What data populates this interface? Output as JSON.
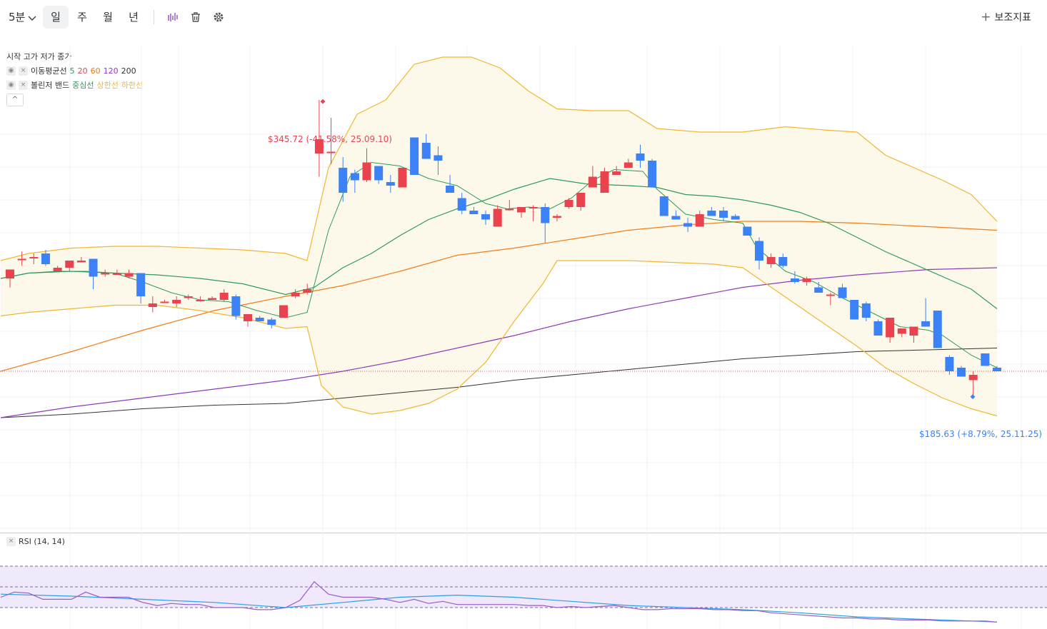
{
  "toolbar": {
    "interval": "5분",
    "day": "일",
    "week": "주",
    "month": "월",
    "year": "년",
    "indicators": "보조지표"
  },
  "legend": {
    "ohlc": "시작 고가 저가 종가",
    "ma_name": "이동평균선",
    "ma_periods": [
      "5",
      "20",
      "60",
      "120",
      "200"
    ],
    "bb_name": "볼린저 밴드",
    "bb_mid": "중심선",
    "bb_upper": "상한선",
    "bb_lower": "하한선"
  },
  "colors": {
    "up": "#e8434f",
    "down": "#3b82f6",
    "ma5": "#2e9b5a",
    "ma20": "#e8434f",
    "ma60": "#f07d1a",
    "ma120": "#8e3bb8",
    "ma200": "#333333",
    "bb_mid": "#2e9b5a",
    "bb_band": "#f2b632",
    "bb_fill": "#fdf9ea",
    "rsi": "#9b5cc4",
    "rsi_signal": "#27a0e8",
    "rsi_band": "#efe9fb"
  },
  "annotations": {
    "high": "$345.72 (-41.58%, 25.09.10)",
    "low": "$185.63 (+8.79%, 25.11.25)"
  },
  "rsi": {
    "label": "RSI (14, 14)"
  },
  "chart_data": {
    "type": "candlestick",
    "ylim": [
      140,
      380
    ],
    "rsi_ylim": [
      0,
      100
    ],
    "candles": [
      [
        248,
        253,
        243,
        253
      ],
      [
        259,
        263,
        255,
        259
      ],
      [
        260,
        262,
        256,
        260
      ],
      [
        262,
        264,
        255,
        256
      ],
      [
        252,
        255,
        252,
        254
      ],
      [
        254,
        258,
        252,
        258
      ],
      [
        257,
        260,
        257,
        258
      ],
      [
        259,
        259,
        242,
        249
      ],
      [
        251,
        253,
        249,
        251
      ],
      [
        250,
        253,
        250,
        251
      ],
      [
        249,
        253,
        248,
        251
      ],
      [
        251,
        251,
        234,
        238
      ],
      [
        232,
        238,
        229,
        234
      ],
      [
        235,
        236,
        235,
        235
      ],
      [
        234,
        238,
        232,
        236
      ],
      [
        237,
        239,
        236,
        238
      ],
      [
        236,
        238,
        235,
        236
      ],
      [
        236,
        238,
        236,
        237
      ],
      [
        236,
        242,
        235,
        240
      ],
      [
        238,
        239,
        225,
        227
      ],
      [
        224,
        228,
        221,
        228
      ],
      [
        226,
        227,
        224,
        224
      ],
      [
        225,
        226,
        220,
        222
      ],
      [
        226,
        233,
        226,
        233
      ],
      [
        238,
        242,
        237,
        240
      ],
      [
        240,
        245,
        239,
        242
      ],
      [
        318,
        348,
        305,
        326
      ],
      [
        319,
        338,
        312,
        319
      ],
      [
        310,
        316,
        291,
        296
      ],
      [
        307,
        309,
        296,
        303
      ],
      [
        303,
        321,
        302,
        313
      ],
      [
        311,
        310,
        301,
        303
      ],
      [
        302,
        306,
        296,
        300
      ],
      [
        299,
        306,
        299,
        310
      ],
      [
        327,
        327,
        306,
        306
      ],
      [
        324,
        329,
        315,
        315
      ],
      [
        317,
        322,
        306,
        314
      ],
      [
        300,
        306,
        297,
        296
      ],
      [
        293,
        296,
        284,
        286
      ],
      [
        286,
        288,
        285,
        284
      ],
      [
        284,
        286,
        278,
        281
      ],
      [
        277,
        289,
        277,
        287
      ],
      [
        287,
        292,
        286,
        287
      ],
      [
        285,
        286,
        282,
        288
      ],
      [
        288,
        289,
        280,
        288
      ],
      [
        288,
        290,
        268,
        279
      ],
      [
        282,
        284,
        280,
        283
      ],
      [
        288,
        293,
        287,
        292
      ],
      [
        288,
        295,
        286,
        296
      ],
      [
        299,
        311,
        299,
        305
      ],
      [
        296,
        310,
        296,
        308
      ],
      [
        306,
        311,
        306,
        308
      ],
      [
        310,
        315,
        310,
        313
      ],
      [
        318,
        323,
        310,
        314
      ],
      [
        314,
        315,
        299,
        299
      ],
      [
        294,
        294,
        283,
        283
      ],
      [
        283,
        286,
        281,
        281
      ],
      [
        279,
        282,
        274,
        277
      ],
      [
        277,
        286,
        277,
        284
      ],
      [
        286,
        288,
        286,
        283
      ],
      [
        286,
        288,
        280,
        282
      ],
      [
        283,
        284,
        282,
        281
      ],
      [
        277,
        277,
        272,
        272
      ],
      [
        269,
        271,
        253,
        258
      ],
      [
        256,
        262,
        254,
        260
      ],
      [
        260,
        262,
        254,
        255
      ],
      [
        248,
        252,
        245,
        246
      ],
      [
        246,
        249,
        244,
        248
      ],
      [
        243,
        246,
        240,
        240
      ],
      [
        239,
        240,
        233,
        239
      ],
      [
        243,
        245,
        237,
        237
      ],
      [
        236,
        235,
        226,
        225
      ],
      [
        234,
        235,
        224,
        226
      ],
      [
        224,
        225,
        217,
        216
      ],
      [
        215,
        220,
        212,
        226
      ],
      [
        217,
        219,
        215,
        220
      ],
      [
        216,
        221,
        212,
        221
      ],
      [
        224,
        237,
        224,
        221
      ],
      [
        230,
        228,
        212,
        209
      ],
      [
        204,
        205,
        194,
        196
      ],
      [
        198,
        199,
        193,
        193
      ],
      [
        191,
        196,
        182,
        194
      ],
      [
        206,
        206,
        199,
        199
      ],
      [
        198,
        199,
        196,
        196
      ]
    ],
    "ma5": [
      [
        1,
        248
      ],
      [
        15,
        249
      ],
      [
        40,
        251
      ],
      [
        80,
        252
      ],
      [
        120,
        252
      ],
      [
        160,
        251
      ],
      [
        200,
        246
      ],
      [
        240,
        240
      ],
      [
        280,
        236
      ],
      [
        320,
        235
      ],
      [
        360,
        230
      ],
      [
        400,
        226
      ],
      [
        430,
        229
      ],
      [
        460,
        275
      ],
      [
        490,
        305
      ],
      [
        520,
        313
      ],
      [
        560,
        311
      ],
      [
        600,
        304
      ],
      [
        640,
        300
      ],
      [
        680,
        290
      ],
      [
        710,
        287
      ],
      [
        740,
        288
      ],
      [
        770,
        287
      ],
      [
        800,
        293
      ],
      [
        830,
        303
      ],
      [
        860,
        309
      ],
      [
        900,
        308
      ],
      [
        920,
        298
      ],
      [
        960,
        284
      ],
      [
        1000,
        281
      ],
      [
        1040,
        279
      ],
      [
        1060,
        265
      ],
      [
        1100,
        252
      ],
      [
        1140,
        246
      ],
      [
        1180,
        237
      ],
      [
        1220,
        229
      ],
      [
        1260,
        221
      ],
      [
        1300,
        219
      ],
      [
        1320,
        216
      ],
      [
        1360,
        205
      ],
      [
        1396,
        198
      ]
    ],
    "bb_mid": [
      [
        1,
        248
      ],
      [
        40,
        251
      ],
      [
        100,
        252
      ],
      [
        160,
        251
      ],
      [
        220,
        250
      ],
      [
        280,
        248
      ],
      [
        340,
        245
      ],
      [
        400,
        239
      ],
      [
        440,
        243
      ],
      [
        480,
        254
      ],
      [
        520,
        262
      ],
      [
        560,
        272
      ],
      [
        600,
        281
      ],
      [
        640,
        287
      ],
      [
        680,
        292
      ],
      [
        720,
        298
      ],
      [
        770,
        304
      ],
      [
        820,
        301
      ],
      [
        880,
        300
      ],
      [
        920,
        299
      ],
      [
        960,
        295
      ],
      [
        1000,
        294
      ],
      [
        1040,
        292
      ],
      [
        1080,
        289
      ],
      [
        1120,
        285
      ],
      [
        1160,
        279
      ],
      [
        1200,
        271
      ],
      [
        1240,
        263
      ],
      [
        1280,
        256
      ],
      [
        1320,
        249
      ],
      [
        1360,
        242
      ],
      [
        1396,
        231
      ]
    ],
    "bb_upper": [
      [
        1,
        258
      ],
      [
        40,
        262
      ],
      [
        100,
        265
      ],
      [
        160,
        266
      ],
      [
        220,
        266
      ],
      [
        280,
        265
      ],
      [
        340,
        264
      ],
      [
        400,
        262
      ],
      [
        430,
        258
      ],
      [
        460,
        310
      ],
      [
        500,
        340
      ],
      [
        540,
        348
      ],
      [
        580,
        368
      ],
      [
        620,
        372
      ],
      [
        660,
        372
      ],
      [
        700,
        366
      ],
      [
        740,
        353
      ],
      [
        780,
        343
      ],
      [
        830,
        342
      ],
      [
        880,
        342
      ],
      [
        920,
        332
      ],
      [
        980,
        330
      ],
      [
        1040,
        330
      ],
      [
        1100,
        333
      ],
      [
        1160,
        331
      ],
      [
        1200,
        330
      ],
      [
        1240,
        317
      ],
      [
        1280,
        310
      ],
      [
        1320,
        303
      ],
      [
        1360,
        295
      ],
      [
        1396,
        280
      ]
    ],
    "bb_lower": [
      [
        1,
        227
      ],
      [
        40,
        229
      ],
      [
        100,
        231
      ],
      [
        160,
        233
      ],
      [
        220,
        233
      ],
      [
        280,
        230
      ],
      [
        340,
        226
      ],
      [
        380,
        222
      ],
      [
        400,
        220
      ],
      [
        430,
        221
      ],
      [
        450,
        188
      ],
      [
        480,
        176
      ],
      [
        520,
        172
      ],
      [
        560,
        174
      ],
      [
        600,
        178
      ],
      [
        640,
        186
      ],
      [
        680,
        201
      ],
      [
        720,
        224
      ],
      [
        760,
        245
      ],
      [
        780,
        258
      ],
      [
        830,
        258
      ],
      [
        880,
        258
      ],
      [
        940,
        257
      ],
      [
        1000,
        256
      ],
      [
        1040,
        254
      ],
      [
        1080,
        243
      ],
      [
        1120,
        232
      ],
      [
        1160,
        221
      ],
      [
        1200,
        210
      ],
      [
        1240,
        198
      ],
      [
        1280,
        189
      ],
      [
        1320,
        181
      ],
      [
        1360,
        175
      ],
      [
        1396,
        171
      ]
    ],
    "ma60": [
      [
        1,
        196
      ],
      [
        100,
        207
      ],
      [
        200,
        219
      ],
      [
        300,
        230
      ],
      [
        400,
        238
      ],
      [
        480,
        244
      ],
      [
        560,
        252
      ],
      [
        640,
        261
      ],
      [
        720,
        265
      ],
      [
        800,
        270
      ],
      [
        880,
        275
      ],
      [
        960,
        278
      ],
      [
        1040,
        280
      ],
      [
        1120,
        280
      ],
      [
        1200,
        279
      ],
      [
        1300,
        277
      ],
      [
        1396,
        275
      ]
    ],
    "ma120": [
      [
        1,
        170
      ],
      [
        100,
        176
      ],
      [
        200,
        181
      ],
      [
        300,
        186
      ],
      [
        400,
        191
      ],
      [
        480,
        196
      ],
      [
        560,
        202
      ],
      [
        640,
        209
      ],
      [
        720,
        216
      ],
      [
        800,
        224
      ],
      [
        880,
        231
      ],
      [
        960,
        237
      ],
      [
        1040,
        243
      ],
      [
        1120,
        247
      ],
      [
        1200,
        250
      ],
      [
        1300,
        253
      ],
      [
        1396,
        254
      ]
    ],
    "ma200": [
      [
        1,
        170
      ],
      [
        100,
        172
      ],
      [
        200,
        175
      ],
      [
        300,
        177
      ],
      [
        400,
        178
      ],
      [
        480,
        181
      ],
      [
        560,
        184
      ],
      [
        640,
        187
      ],
      [
        720,
        191
      ],
      [
        800,
        194
      ],
      [
        880,
        197
      ],
      [
        960,
        200
      ],
      [
        1040,
        203
      ],
      [
        1120,
        205
      ],
      [
        1200,
        207
      ],
      [
        1300,
        208
      ],
      [
        1396,
        209
      ]
    ],
    "current_price": 196,
    "high": 345.72,
    "low": 185.63,
    "rsi_values": [
      [
        1,
        40
      ],
      [
        20,
        45
      ],
      [
        40,
        44
      ],
      [
        60,
        38
      ],
      [
        80,
        38
      ],
      [
        100,
        38
      ],
      [
        120,
        45
      ],
      [
        140,
        40
      ],
      [
        160,
        40
      ],
      [
        180,
        40
      ],
      [
        200,
        35
      ],
      [
        220,
        32
      ],
      [
        240,
        34
      ],
      [
        260,
        33
      ],
      [
        280,
        33
      ],
      [
        300,
        30
      ],
      [
        320,
        30
      ],
      [
        340,
        30
      ],
      [
        360,
        28
      ],
      [
        380,
        28
      ],
      [
        400,
        30
      ],
      [
        420,
        37
      ],
      [
        440,
        55
      ],
      [
        460,
        43
      ],
      [
        480,
        40
      ],
      [
        500,
        40
      ],
      [
        520,
        40
      ],
      [
        540,
        38
      ],
      [
        560,
        35
      ],
      [
        580,
        38
      ],
      [
        600,
        34
      ],
      [
        620,
        36
      ],
      [
        640,
        33
      ],
      [
        660,
        33
      ],
      [
        680,
        33
      ],
      [
        700,
        33
      ],
      [
        720,
        33
      ],
      [
        740,
        32
      ],
      [
        760,
        32
      ],
      [
        780,
        30
      ],
      [
        800,
        31
      ],
      [
        820,
        30
      ],
      [
        840,
        31
      ],
      [
        860,
        32
      ],
      [
        880,
        30
      ],
      [
        900,
        28
      ],
      [
        920,
        28
      ],
      [
        940,
        29
      ],
      [
        960,
        29
      ],
      [
        980,
        29
      ],
      [
        1000,
        28
      ],
      [
        1020,
        28
      ],
      [
        1040,
        27
      ],
      [
        1060,
        27
      ],
      [
        1080,
        25
      ],
      [
        1100,
        24
      ],
      [
        1120,
        23
      ],
      [
        1140,
        22
      ],
      [
        1160,
        21
      ],
      [
        1180,
        20
      ],
      [
        1200,
        20
      ],
      [
        1220,
        19
      ],
      [
        1240,
        19
      ],
      [
        1260,
        18
      ],
      [
        1280,
        18
      ],
      [
        1300,
        18
      ],
      [
        1320,
        17
      ],
      [
        1340,
        17
      ],
      [
        1360,
        17
      ],
      [
        1380,
        17
      ],
      [
        1396,
        16
      ]
    ],
    "rsi_signal": [
      [
        1,
        43
      ],
      [
        100,
        41
      ],
      [
        200,
        38
      ],
      [
        300,
        35
      ],
      [
        400,
        30
      ],
      [
        480,
        35
      ],
      [
        560,
        40
      ],
      [
        640,
        42
      ],
      [
        720,
        40
      ],
      [
        800,
        36
      ],
      [
        880,
        32
      ],
      [
        960,
        30
      ],
      [
        1040,
        28
      ],
      [
        1120,
        25
      ],
      [
        1200,
        21
      ],
      [
        1280,
        19
      ],
      [
        1360,
        17
      ],
      [
        1396,
        16
      ]
    ],
    "rsi_levels": [
      30,
      50,
      70
    ]
  }
}
